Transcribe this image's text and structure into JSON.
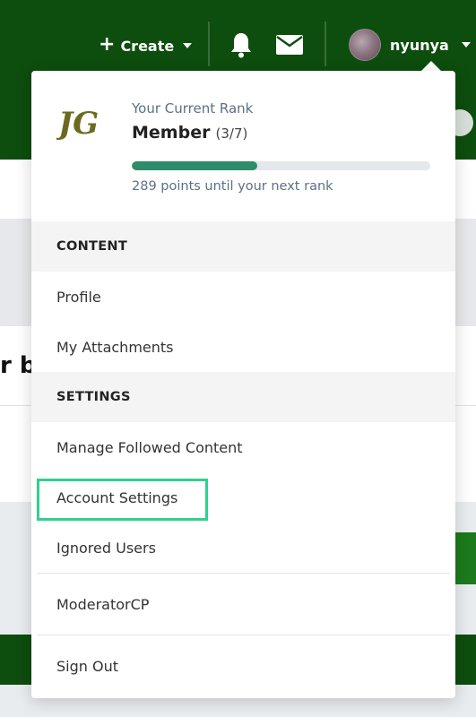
{
  "header": {
    "create_label": "Create",
    "username": "nyunya"
  },
  "background": {
    "partial_heading": "r b"
  },
  "rank": {
    "logo_text": "JG",
    "label": "Your Current Rank",
    "name": "Member",
    "count": "(3/7)",
    "progress_fraction": 0.42,
    "progress_text": "289 points until your next rank"
  },
  "menu": {
    "content_header": "CONTENT",
    "profile": "Profile",
    "attachments": "My Attachments",
    "settings_header": "SETTINGS",
    "followed": "Manage Followed Content",
    "account_settings": "Account Settings",
    "ignored": "Ignored Users",
    "moderator": "ModeratorCP",
    "sign_out": "Sign Out"
  },
  "colors": {
    "header_bg": "#0d4d0d",
    "progress_fill": "#2f8c6a",
    "highlight": "#2fd18c"
  }
}
